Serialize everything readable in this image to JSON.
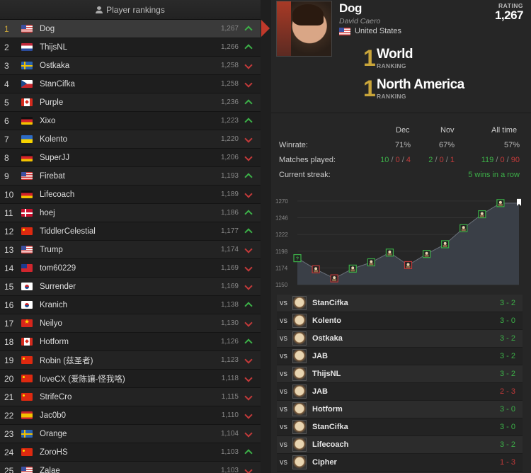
{
  "rankings": {
    "header": "Player rankings",
    "rows": [
      {
        "pos": "1",
        "flag": "us",
        "name": "Dog",
        "rating": "1,267",
        "trend": "up",
        "active": true
      },
      {
        "pos": "2",
        "flag": "nl",
        "name": "ThijsNL",
        "rating": "1,266",
        "trend": "up"
      },
      {
        "pos": "3",
        "flag": "se",
        "name": "Ostkaka",
        "rating": "1,258",
        "trend": "down"
      },
      {
        "pos": "4",
        "flag": "cz",
        "name": "StanCifka",
        "rating": "1,258",
        "trend": "down"
      },
      {
        "pos": "5",
        "flag": "ca",
        "name": "Purple",
        "rating": "1,236",
        "trend": "up"
      },
      {
        "pos": "6",
        "flag": "de",
        "name": "Xixo",
        "rating": "1,223",
        "trend": "up"
      },
      {
        "pos": "7",
        "flag": "ua",
        "name": "Kolento",
        "rating": "1,220",
        "trend": "down"
      },
      {
        "pos": "8",
        "flag": "de",
        "name": "SuperJJ",
        "rating": "1,206",
        "trend": "down"
      },
      {
        "pos": "9",
        "flag": "us",
        "name": "Firebat",
        "rating": "1,193",
        "trend": "up"
      },
      {
        "pos": "10",
        "flag": "de",
        "name": "Lifecoach",
        "rating": "1,189",
        "trend": "down"
      },
      {
        "pos": "11",
        "flag": "dk",
        "name": "hoej",
        "rating": "1,186",
        "trend": "up"
      },
      {
        "pos": "12",
        "flag": "cn",
        "name": "TiddlerCelestial",
        "rating": "1,177",
        "trend": "up"
      },
      {
        "pos": "13",
        "flag": "us",
        "name": "Trump",
        "rating": "1,174",
        "trend": "down"
      },
      {
        "pos": "14",
        "flag": "tw",
        "name": "tom60229",
        "rating": "1,169",
        "trend": "down"
      },
      {
        "pos": "15",
        "flag": "kr",
        "name": "Surrender",
        "rating": "1,169",
        "trend": "down"
      },
      {
        "pos": "16",
        "flag": "kr",
        "name": "Kranich",
        "rating": "1,138",
        "trend": "up"
      },
      {
        "pos": "17",
        "flag": "vn",
        "name": "Neilyo",
        "rating": "1,130",
        "trend": "down"
      },
      {
        "pos": "18",
        "flag": "ca",
        "name": "Hotform",
        "rating": "1,126",
        "trend": "up"
      },
      {
        "pos": "19",
        "flag": "cn",
        "name": "Robin (兹圣者)",
        "rating": "1,123",
        "trend": "down"
      },
      {
        "pos": "20",
        "flag": "cn",
        "name": "loveCX (爱陈讓-怪我咯)",
        "rating": "1,118",
        "trend": "down"
      },
      {
        "pos": "21",
        "flag": "cn",
        "name": "StrifeCro",
        "rating": "1,115",
        "trend": "down"
      },
      {
        "pos": "22",
        "flag": "es",
        "name": "Jac0b0",
        "rating": "1,110",
        "trend": "down"
      },
      {
        "pos": "23",
        "flag": "se",
        "name": "Orange",
        "rating": "1,104",
        "trend": "down"
      },
      {
        "pos": "24",
        "flag": "cn",
        "name": "ZoroHS",
        "rating": "1,103",
        "trend": "up"
      },
      {
        "pos": "25",
        "flag": "us",
        "name": "Zalae",
        "rating": "1,103",
        "trend": "down"
      }
    ]
  },
  "profile": {
    "name": "Dog",
    "real_name": "David Caero",
    "country": "United States",
    "rating_label": "RATING",
    "rating": "1,267",
    "world_rank": "1",
    "world_label": "World",
    "region_rank": "1",
    "region_label": "North America",
    "ranking_label": "RANKING"
  },
  "stats": {
    "columns": [
      "Dec",
      "Nov",
      "All time"
    ],
    "winrate_label": "Winrate:",
    "winrate": [
      "71%",
      "67%",
      "57%"
    ],
    "matches_label": "Matches played:",
    "matches": [
      {
        "w": "10",
        "d": "0",
        "l": "4"
      },
      {
        "w": "2",
        "d": "0",
        "l": "1"
      },
      {
        "w": "119",
        "d": "0",
        "l": "90"
      }
    ],
    "streak_label": "Current streak:",
    "streak": "5 wins in a row"
  },
  "chart_data": {
    "type": "area",
    "yticks": [
      1270,
      1246,
      1222,
      1198,
      1174,
      1150
    ],
    "ylim": [
      1150,
      1278
    ],
    "values": [
      1188,
      1172,
      1159,
      1173,
      1182,
      1196,
      1178,
      1194,
      1208,
      1231,
      1251,
      1267,
      1267
    ],
    "results": [
      "start",
      "L",
      "L",
      "W",
      "W",
      "W",
      "L",
      "W",
      "W",
      "W",
      "W",
      "W",
      "end"
    ]
  },
  "matches": {
    "vs_label": "vs",
    "items": [
      {
        "opponent": "StanCifka",
        "score": "3 - 2",
        "result": "win"
      },
      {
        "opponent": "Kolento",
        "score": "3 - 0",
        "result": "win"
      },
      {
        "opponent": "Ostkaka",
        "score": "3 - 2",
        "result": "win"
      },
      {
        "opponent": "JAB",
        "score": "3 - 2",
        "result": "win"
      },
      {
        "opponent": "ThijsNL",
        "score": "3 - 2",
        "result": "win"
      },
      {
        "opponent": "JAB",
        "score": "2 - 3",
        "result": "loss"
      },
      {
        "opponent": "Hotform",
        "score": "3 - 0",
        "result": "win"
      },
      {
        "opponent": "StanCifka",
        "score": "3 - 0",
        "result": "win"
      },
      {
        "opponent": "Lifecoach",
        "score": "3 - 2",
        "result": "win"
      },
      {
        "opponent": "Cipher",
        "score": "1 - 3",
        "result": "loss"
      }
    ]
  },
  "colors": {
    "win": "#3cb048",
    "loss": "#c23a3a",
    "gold": "#c9a53a",
    "accent": "#c0392b"
  }
}
